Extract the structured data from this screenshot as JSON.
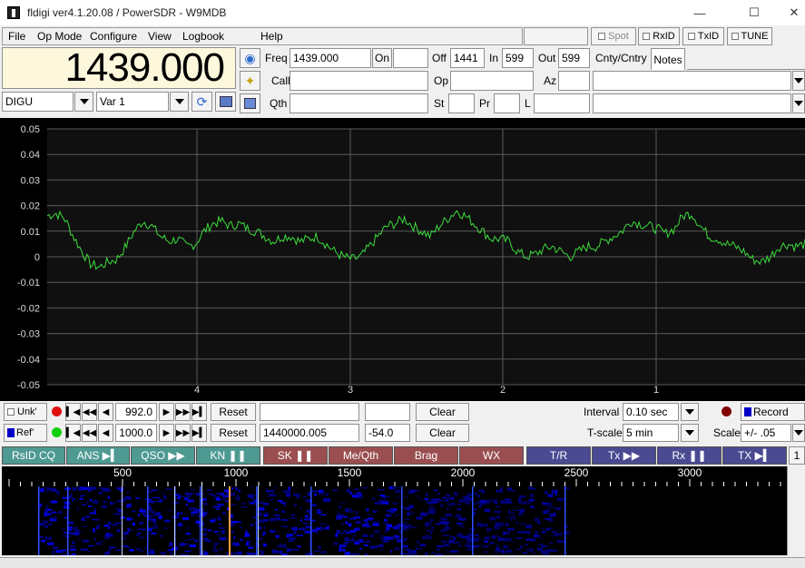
{
  "window": {
    "title": "fldigi ver4.1.20.08 / PowerSDR - W9MDB",
    "minimize": "—",
    "maximize": "☐",
    "close": "✕"
  },
  "menu": {
    "file": "File",
    "op_mode": "Op Mode",
    "configure": "Configure",
    "view": "View",
    "logbook": "Logbook",
    "help": "Help"
  },
  "toprightbtns": {
    "spot": "Spot",
    "rxid": "RxID",
    "txid": "TxID",
    "tune": "TUNE"
  },
  "frequency_display": "1439.000",
  "mode": "DIGU",
  "bandwidth": "Var 1",
  "log": {
    "freq_label": "Freq",
    "freq_value": "1439.000",
    "on_label": "On",
    "on_value": "",
    "off_label": "Off",
    "off_value": "1441",
    "in_label": "In",
    "in_value": "599",
    "out_label": "Out",
    "out_value": "599",
    "cnty_label": "Cnty/Cntry",
    "notes_label": "Notes",
    "call_label": "Call",
    "op_label": "Op",
    "az_label": "Az",
    "qth_label": "Qth",
    "st_label": "St",
    "pr_label": "Pr",
    "l_label": "L"
  },
  "chart_data": {
    "type": "line",
    "ylim": [
      -0.05,
      0.05
    ],
    "yticks": [
      "0.05",
      "0.04",
      "0.03",
      "0.02",
      "0.01",
      "0",
      "-0.01",
      "-0.02",
      "-0.03",
      "-0.04",
      "-0.05"
    ],
    "xticks": [
      "4",
      "3",
      "2",
      "1"
    ],
    "grid": true,
    "series_color": "#3cdc3c",
    "values": [
      0.016,
      0.017,
      0.015,
      0.008,
      0.002,
      -0.003,
      -0.004,
      -0.002,
      -0.001,
      0.004,
      0.01,
      0.014,
      0.012,
      0.008,
      0.006,
      0.007,
      0.004,
      0.005,
      0.01,
      0.013,
      0.014,
      0.012,
      0.013,
      0.011,
      0.01,
      0.008,
      0.006,
      0.008,
      0.008,
      0.006,
      0.007,
      0.008,
      0.005,
      0.002,
      0.0,
      -0.001,
      0.0,
      0.004,
      0.008,
      0.012,
      0.013,
      0.015,
      0.012,
      0.01,
      0.008,
      0.012,
      0.015,
      0.018,
      0.016,
      0.013,
      0.01,
      0.007,
      0.007,
      0.006,
      0.002,
      0.0,
      0.001,
      0.003,
      0.004,
      0.002,
      -0.0,
      0.002,
      0.004,
      0.004,
      0.006,
      0.008,
      0.01,
      0.014,
      0.013,
      0.012,
      0.011,
      0.009,
      0.011,
      0.016,
      0.017,
      0.012,
      0.008,
      0.007,
      0.005,
      0.004,
      0.002,
      -0.001,
      -0.002,
      0.0,
      0.004,
      0.005,
      0.004,
      0.005
    ]
  },
  "ctrl1": {
    "label": "Unk'",
    "value": "992.0",
    "reset": "Reset",
    "text1": "",
    "text2": "",
    "clear": "Clear",
    "interval_label": "Interval",
    "interval_value": "0.10 sec",
    "record": "Record"
  },
  "ctrl2": {
    "label": "Ref'",
    "value": "1000.0",
    "reset": "Reset",
    "text1": "1440000.005",
    "text2": "-54.0",
    "clear": "Clear",
    "tscale_label": "T-scale",
    "tscale_value": "5  min",
    "scale_label": "Scale",
    "scale_value": "+/- .05"
  },
  "macros": [
    "RsID CQ",
    "ANS ▶▍",
    "QSO ▶▶",
    "KN ❚❚",
    "SK ❚❚",
    "Me/Qth",
    "Brag",
    "WX",
    "T/R",
    "Tx ▶▶",
    "Rx ❚❚",
    "TX ▶▍"
  ],
  "macro_extra": "1",
  "macro_colors": {
    "teal": "#4e9a92",
    "brown": "#9a4e50",
    "blue": "#4a4a92"
  },
  "waterfall_scale": [
    "500",
    "1000",
    "1500",
    "2000",
    "2500",
    "3000"
  ]
}
